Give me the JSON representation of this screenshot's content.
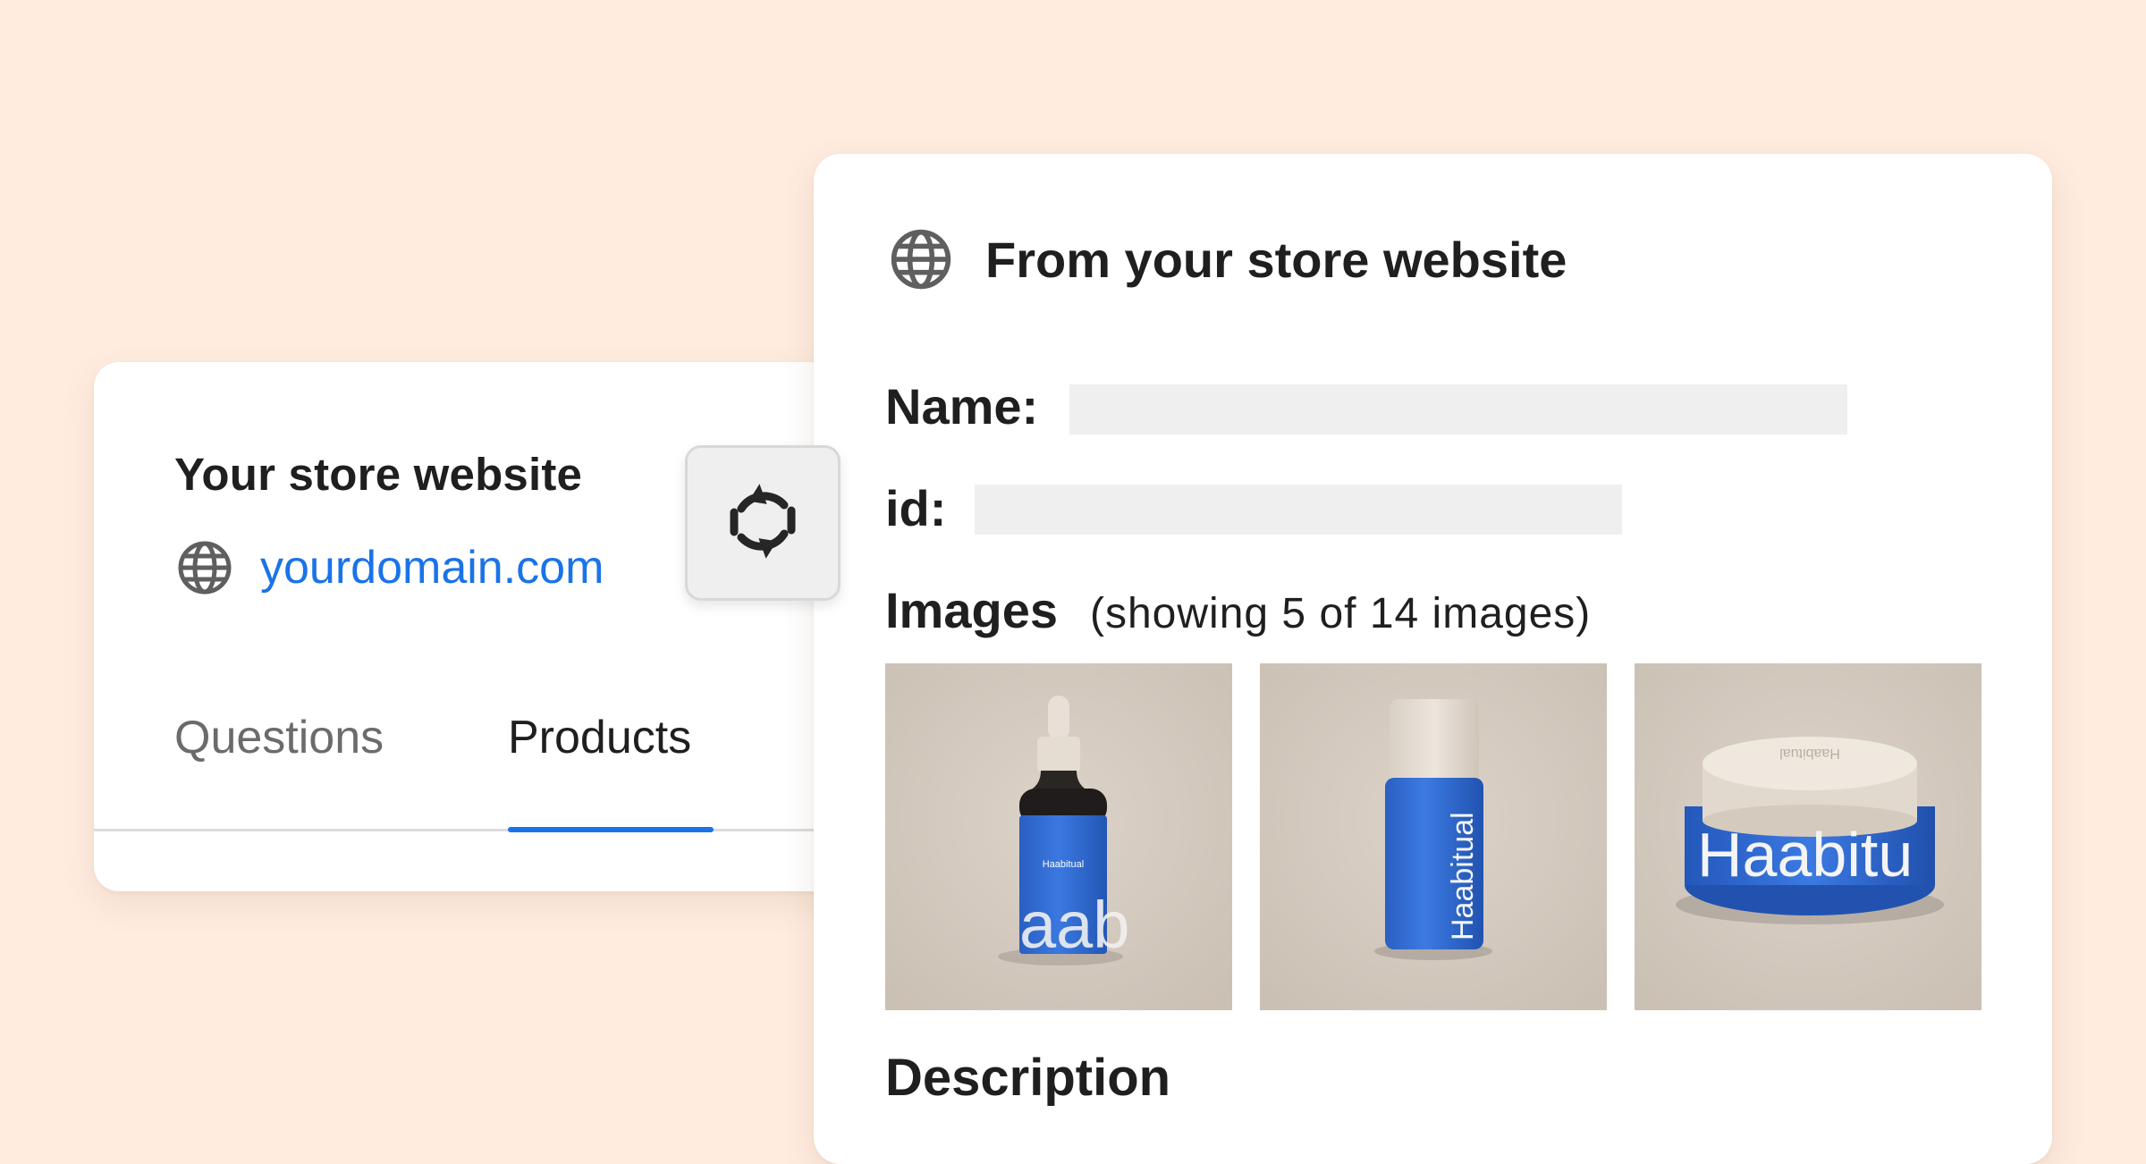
{
  "colors": {
    "background": "#FFECDF",
    "accent": "#1a73e8",
    "product_blue": "#2f6fd8",
    "placeholder": "#efefef"
  },
  "left_card": {
    "title": "Your store website",
    "domain": "yourdomain.com",
    "domain_icon": "globe-icon",
    "tabs": [
      {
        "label": "Questions",
        "active": false
      },
      {
        "label": "Products",
        "active": true
      }
    ]
  },
  "sync_button": {
    "icon": "sync-icon"
  },
  "right_card": {
    "header_icon": "globe-icon",
    "title": "From your store website",
    "name_label": "Name:",
    "id_label": "id:",
    "images_label": "Images",
    "images_count": "(showing 5 of 14 images)",
    "images": [
      {
        "alt": "dropper-bottle",
        "brand_text": "Haabitual",
        "big_text": "aab"
      },
      {
        "alt": "tube-bottle",
        "brand_text": "Haabitual"
      },
      {
        "alt": "jar",
        "brand_text": "Haabitual"
      }
    ],
    "description_label": "Description"
  }
}
